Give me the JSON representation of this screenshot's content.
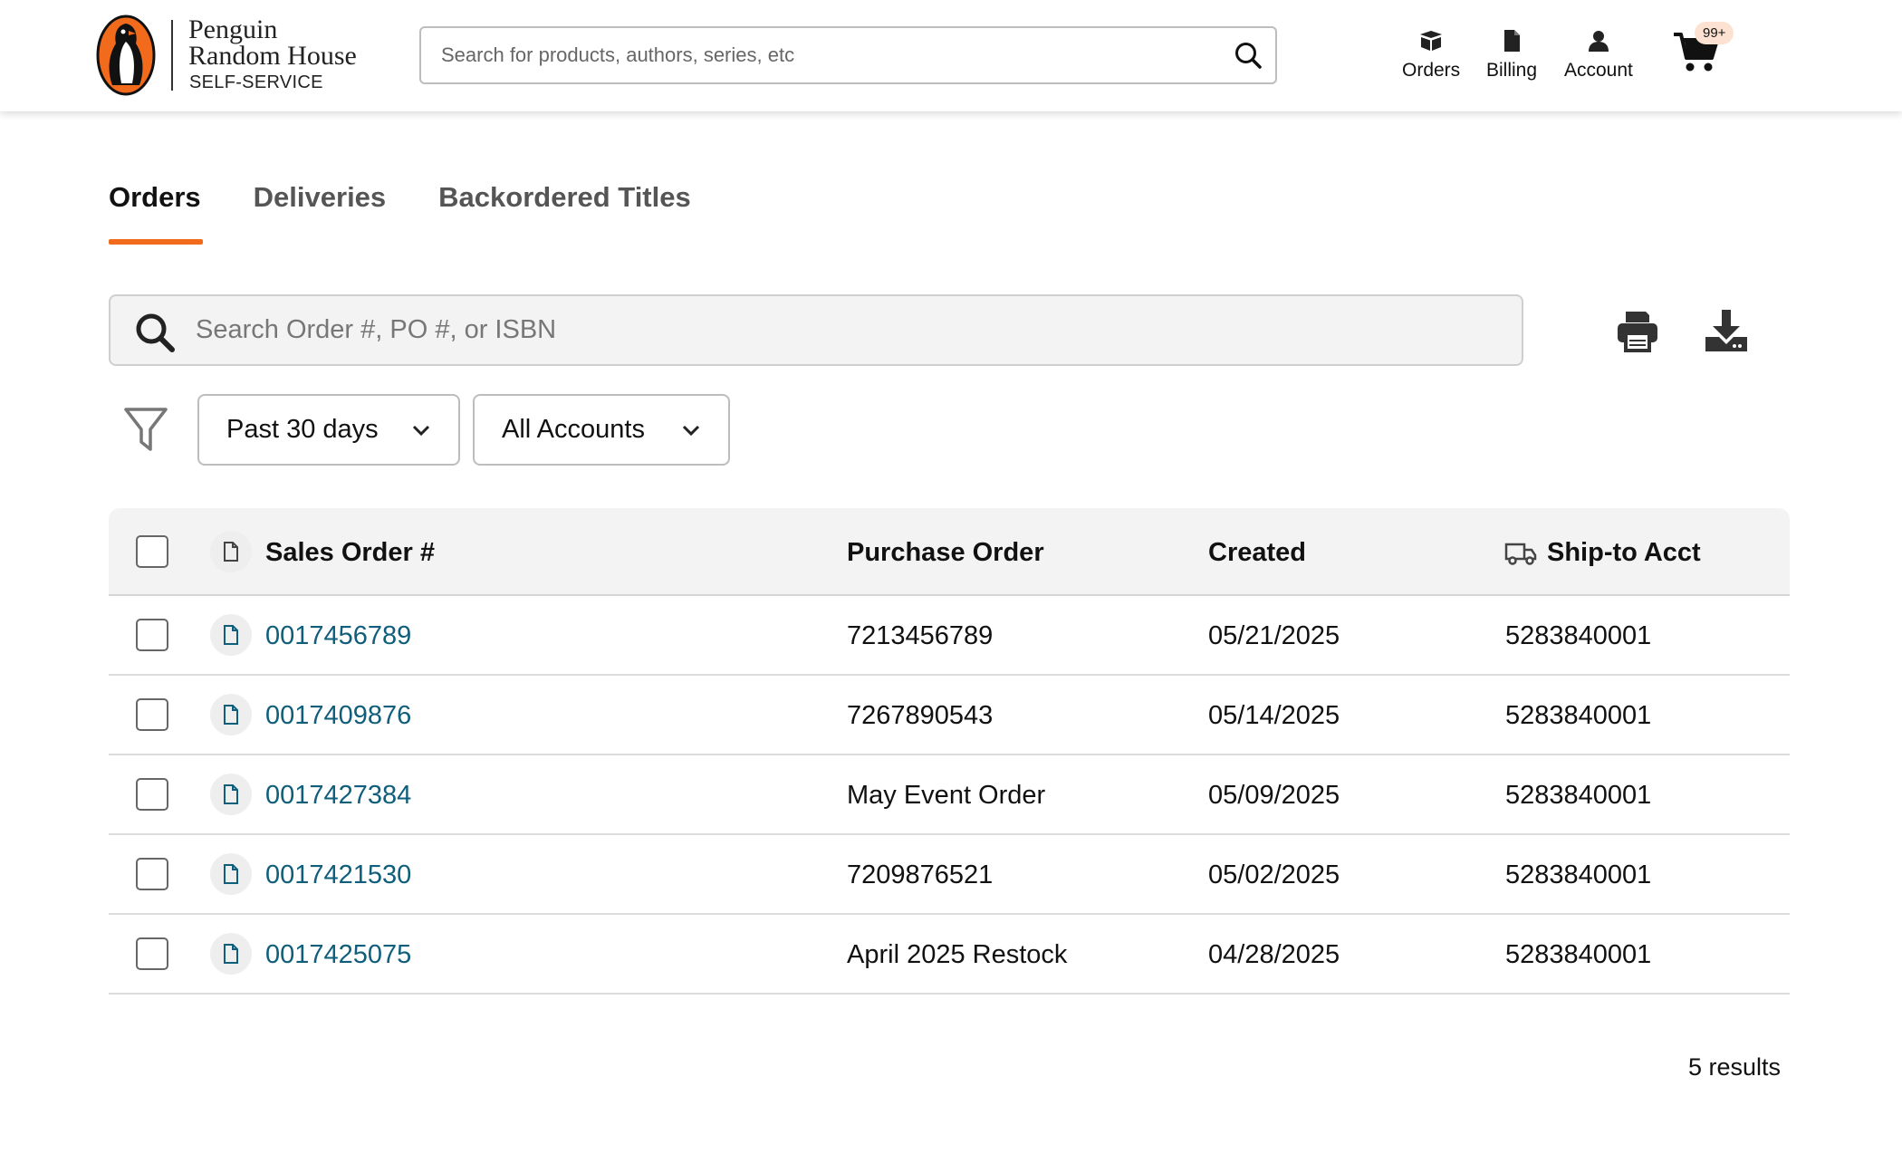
{
  "header": {
    "brand_line1": "Penguin",
    "brand_line2": "Random House",
    "brand_sub": "SELF-SERVICE",
    "search_placeholder": "Search for products, authors, series, etc",
    "nav": [
      {
        "label": "Orders",
        "icon": "box-icon"
      },
      {
        "label": "Billing",
        "icon": "document-icon"
      },
      {
        "label": "Account",
        "icon": "person-icon"
      }
    ],
    "cart_badge": "99+"
  },
  "tabs": [
    {
      "label": "Orders",
      "active": true
    },
    {
      "label": "Deliveries",
      "active": false
    },
    {
      "label": "Backordered Titles",
      "active": false
    }
  ],
  "order_search": {
    "placeholder": "Search Order #, PO #, or ISBN"
  },
  "filters": {
    "date_range": "Past 30 days",
    "accounts": "All Accounts"
  },
  "table": {
    "columns": [
      "Sales Order #",
      "Purchase Order",
      "Created",
      "Ship-to Acct"
    ],
    "rows": [
      {
        "sales_order": "0017456789",
        "purchase_order": "7213456789",
        "created": "05/21/2025",
        "ship_to": "5283840001"
      },
      {
        "sales_order": "0017409876",
        "purchase_order": "7267890543",
        "created": "05/14/2025",
        "ship_to": "5283840001"
      },
      {
        "sales_order": "0017427384",
        "purchase_order": "May Event Order",
        "created": "05/09/2025",
        "ship_to": "5283840001"
      },
      {
        "sales_order": "0017421530",
        "purchase_order": "7209876521",
        "created": "05/02/2025",
        "ship_to": "5283840001"
      },
      {
        "sales_order": "0017425075",
        "purchase_order": "April 2025 Restock",
        "created": "04/28/2025",
        "ship_to": "5283840001"
      }
    ]
  },
  "results_text": "5 results",
  "colors": {
    "accent": "#f26a1b",
    "link": "#0f5e7c"
  }
}
